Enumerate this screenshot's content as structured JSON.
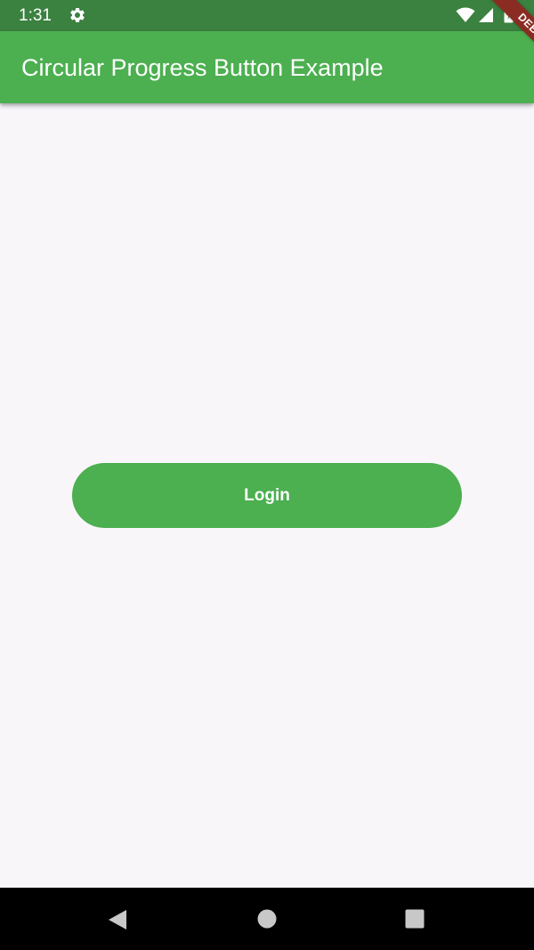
{
  "status_bar": {
    "time": "1:31",
    "icons": [
      "gear-icon",
      "wifi-icon",
      "signal-icon",
      "battery-icon"
    ],
    "background": "#3b8140"
  },
  "app_bar": {
    "title": "Circular Progress Button Example",
    "background": "#4caf50"
  },
  "debug_banner": {
    "label": "DEBUG",
    "color": "#8b2c22"
  },
  "main": {
    "background": "#f8f6f9",
    "login_button": {
      "label": "Login",
      "color": "#4caf50"
    }
  },
  "nav_bar": {
    "items": [
      "back-icon",
      "home-icon",
      "recents-icon"
    ],
    "background": "#000000"
  }
}
